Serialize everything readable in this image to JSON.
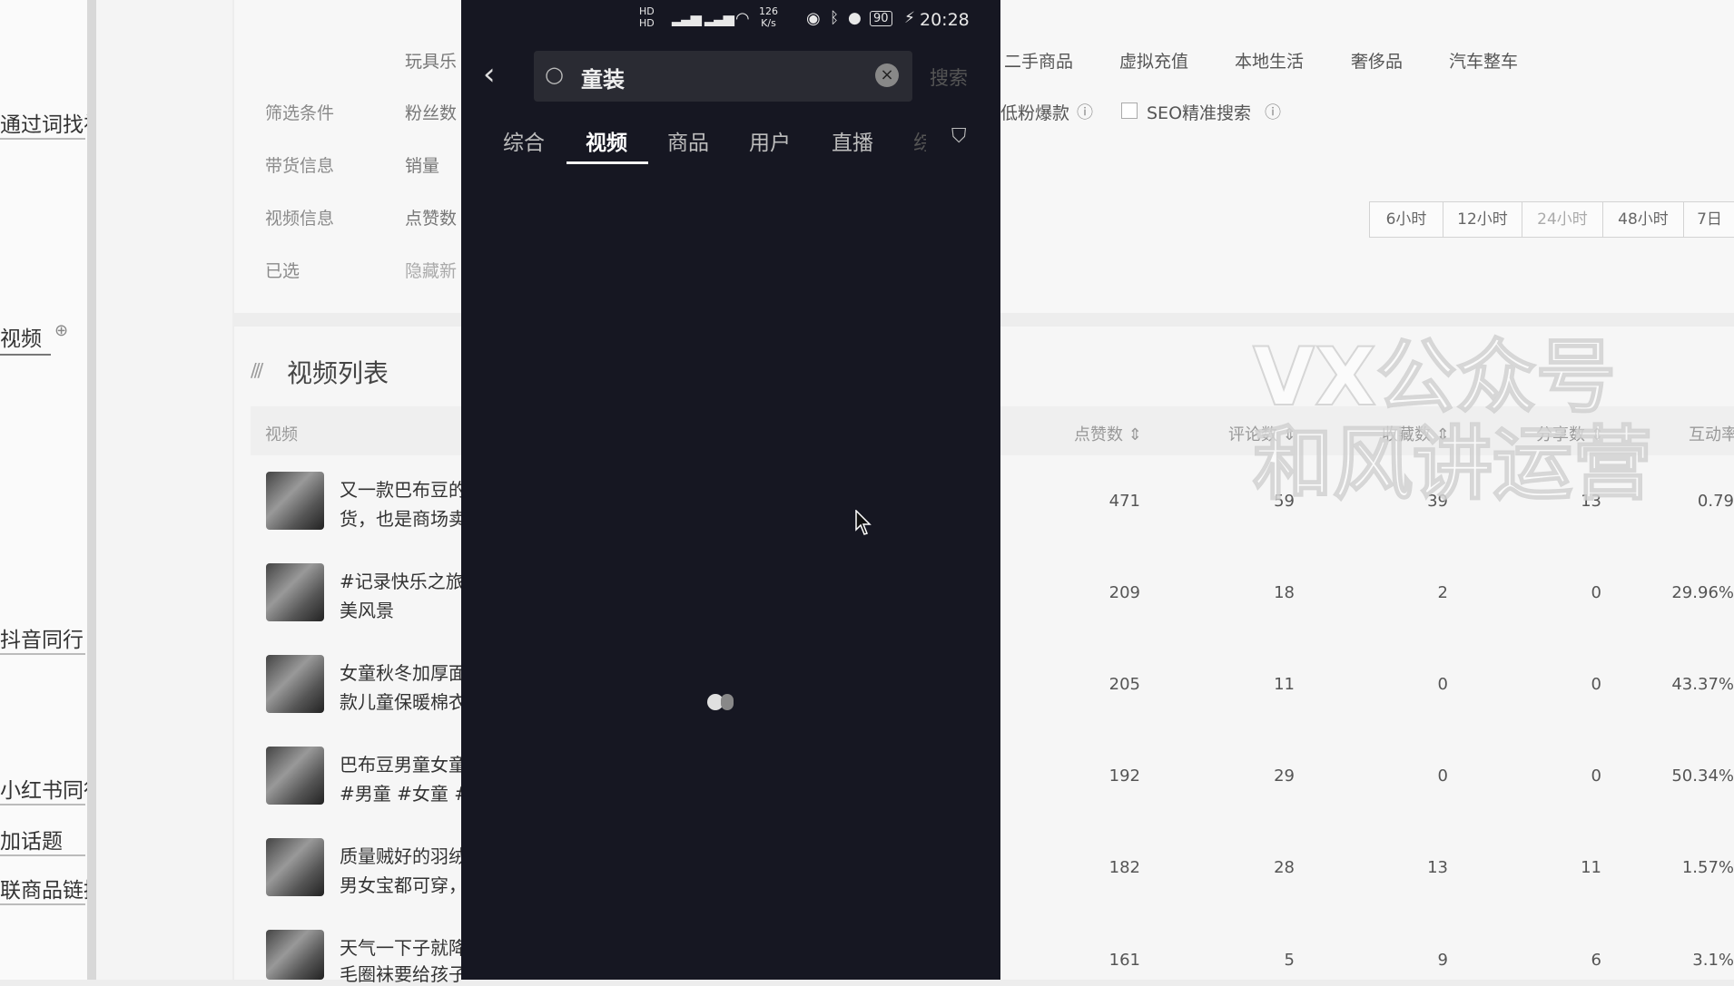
{
  "sidebar": {
    "items": [
      "通过词找视",
      "视频",
      "抖音同行",
      "小红书同行",
      "加话题",
      "联商品链接"
    ]
  },
  "filters": {
    "labels": [
      "筛选条件",
      "带货信息",
      "视频信息",
      "已选"
    ],
    "values": [
      "玩具乐",
      "粉丝数",
      "销量",
      "点赞数",
      "隐藏新"
    ],
    "categories": [
      "二手商品",
      "虚拟充值",
      "本地生活",
      "奢侈品",
      "汽车整车"
    ],
    "low_fans_label": "低粉爆款",
    "seo_label": "SEO精准搜索",
    "time_tabs": [
      "6小时",
      "12小时",
      "24小时",
      "48小时",
      "7日"
    ]
  },
  "list": {
    "heading": "视频列表",
    "col_video": "视频",
    "columns": [
      "点赞数",
      "评论数",
      "收藏数",
      "分享数",
      "互动率"
    ],
    "rows": [
      {
        "line1": "又一款巴布豆的",
        "line2": "货，也是商场卖",
        "likes": "471",
        "comments": "59",
        "favorites": "39",
        "shares": "13",
        "rate": "0.79"
      },
      {
        "line1": "#记录快乐之旅",
        "line2": "美风景",
        "likes": "209",
        "comments": "18",
        "favorites": "2",
        "shares": "0",
        "rate": "29.96%"
      },
      {
        "line1": "女童秋冬加厚面",
        "line2": "款儿童保暖棉衣",
        "likes": "205",
        "comments": "11",
        "favorites": "0",
        "shares": "0",
        "rate": "43.37%"
      },
      {
        "line1": "巴布豆男童女童",
        "line2": "#男童 #女童 #",
        "likes": "192",
        "comments": "29",
        "favorites": "0",
        "shares": "0",
        "rate": "50.34%"
      },
      {
        "line1": "质量贼好的羽绒",
        "line2": "男女宝都可穿，",
        "likes": "182",
        "comments": "28",
        "favorites": "13",
        "shares": "11",
        "rate": "1.57%"
      },
      {
        "line1": "天气一下子就降",
        "line2": "毛圈袜要给孩子",
        "likes": "161",
        "comments": "5",
        "favorites": "9",
        "shares": "6",
        "rate": "3.1%"
      }
    ]
  },
  "phone": {
    "status": {
      "speed": "126",
      "speed_unit": "K/s",
      "battery": "90",
      "time": "20:28"
    },
    "search_query": "童装",
    "search_button": "搜索",
    "tabs": [
      "综合",
      "视频",
      "商品",
      "用户",
      "直播",
      "综"
    ],
    "active_tab": "视频"
  },
  "watermark": {
    "line1": "VX公众号",
    "line2": "和风讲运营"
  },
  "colors": {
    "phone_bg": "#161722",
    "accent": "#ffffff"
  }
}
